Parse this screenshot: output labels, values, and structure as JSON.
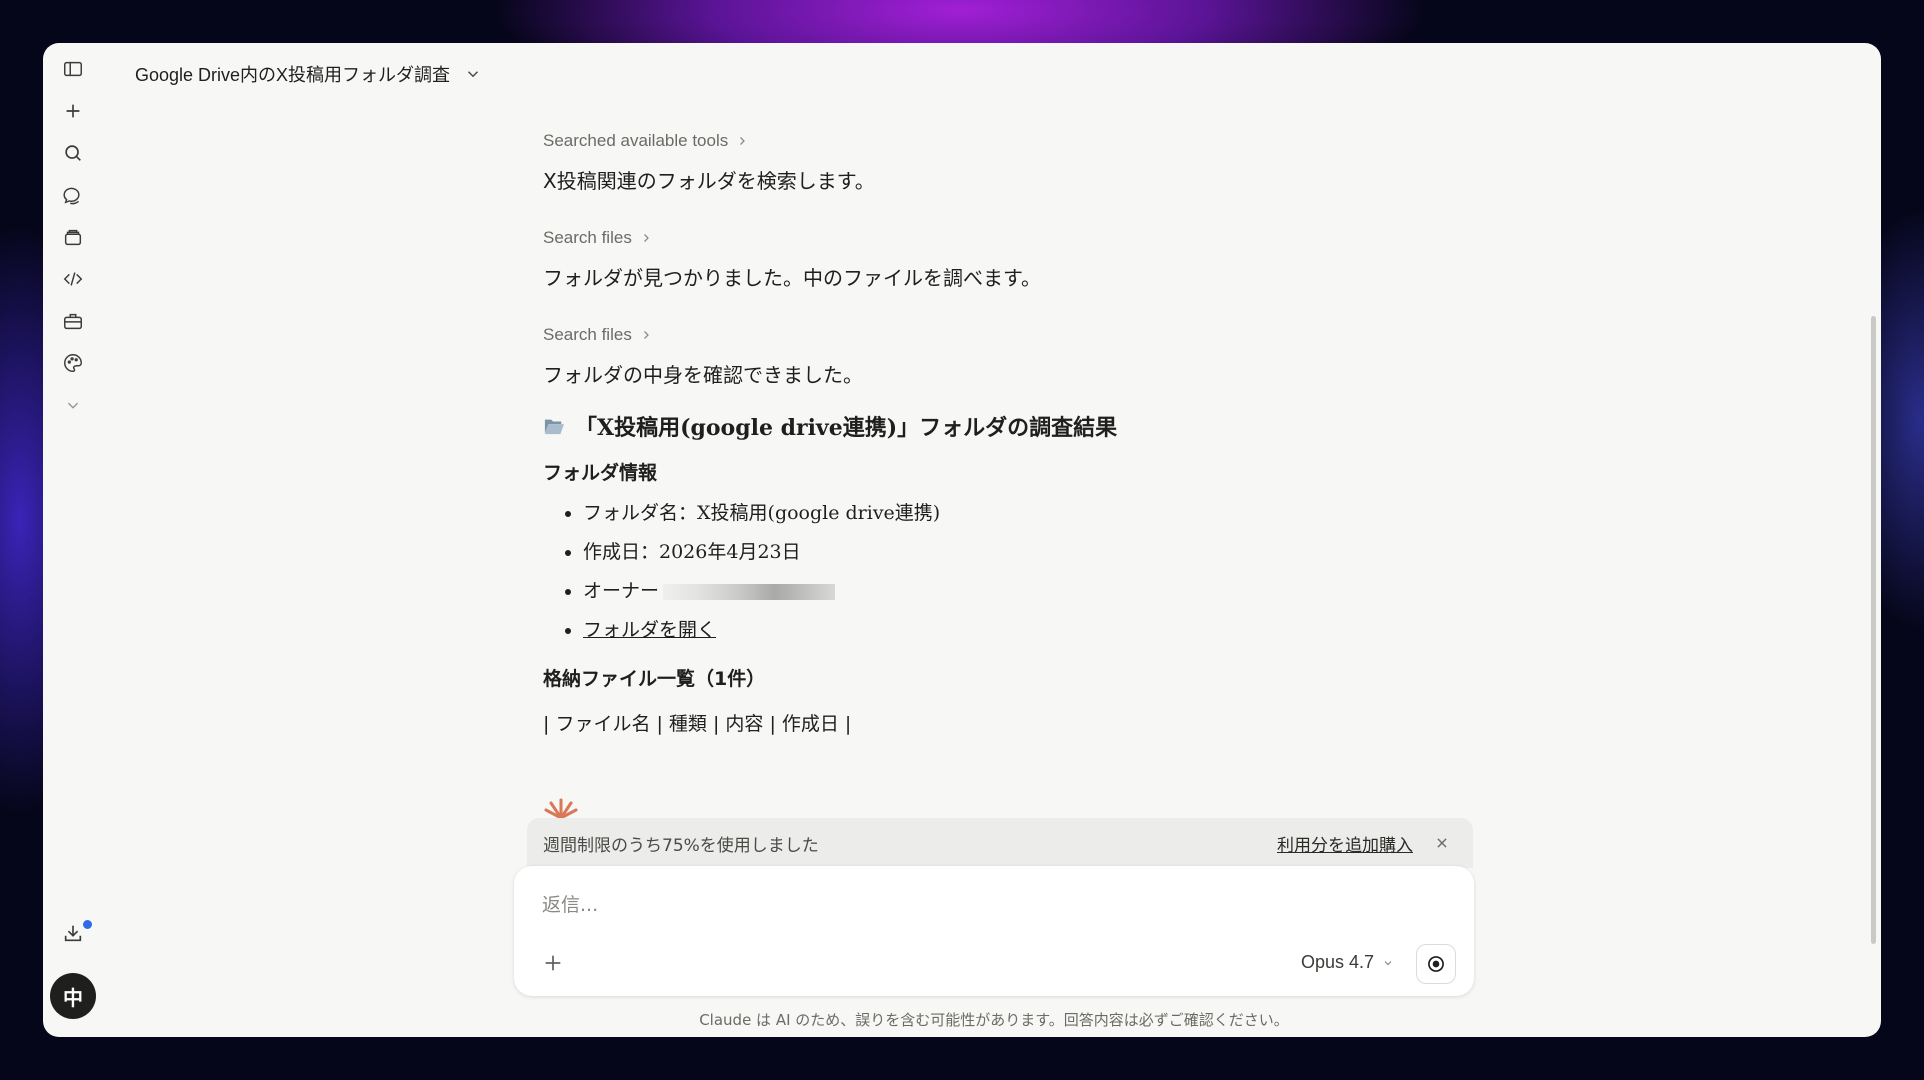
{
  "header": {
    "title": "Google Drive内のX投稿用フォルダ調査"
  },
  "sidebar": {
    "icons": [
      "sidebar-toggle-icon",
      "plus-icon",
      "search-icon",
      "chats-icon",
      "projects-icon",
      "code-icon",
      "toolbox-icon",
      "palette-icon",
      "chevron-down-icon",
      "download-icon"
    ],
    "avatar_label": "中"
  },
  "messages": [
    {
      "tool": "Searched available tools",
      "text": "X投稿関連のフォルダを検索します。"
    },
    {
      "tool": "Search files",
      "text": "フォルダが見つかりました。中のファイルを調べます。"
    },
    {
      "tool": "Search files",
      "text": "フォルダの中身を確認できました。"
    }
  ],
  "result": {
    "heading": "「X投稿用(google drive連携)」フォルダの調査結果",
    "section_info": "フォルダ情報",
    "items": {
      "name": "フォルダ名：X投稿用(google drive連携)",
      "created": "作成日：2026年4月23日",
      "owner": "オーナー",
      "open_link": "フォルダを開く"
    },
    "section_files": "格納ファイル一覧（1件）",
    "table_header": "| ファイル名 | 種類 | 内容 | 作成日 |"
  },
  "usage": {
    "text": "週間制限のうち75%を使用しました",
    "buy_link": "利用分を追加購入"
  },
  "composer": {
    "placeholder": "返信...",
    "model": "Opus 4.7"
  },
  "footer": {
    "disclaimer": "Claude は AI のため、誤りを含む可能性があります。回答内容は必ずご確認ください。"
  }
}
